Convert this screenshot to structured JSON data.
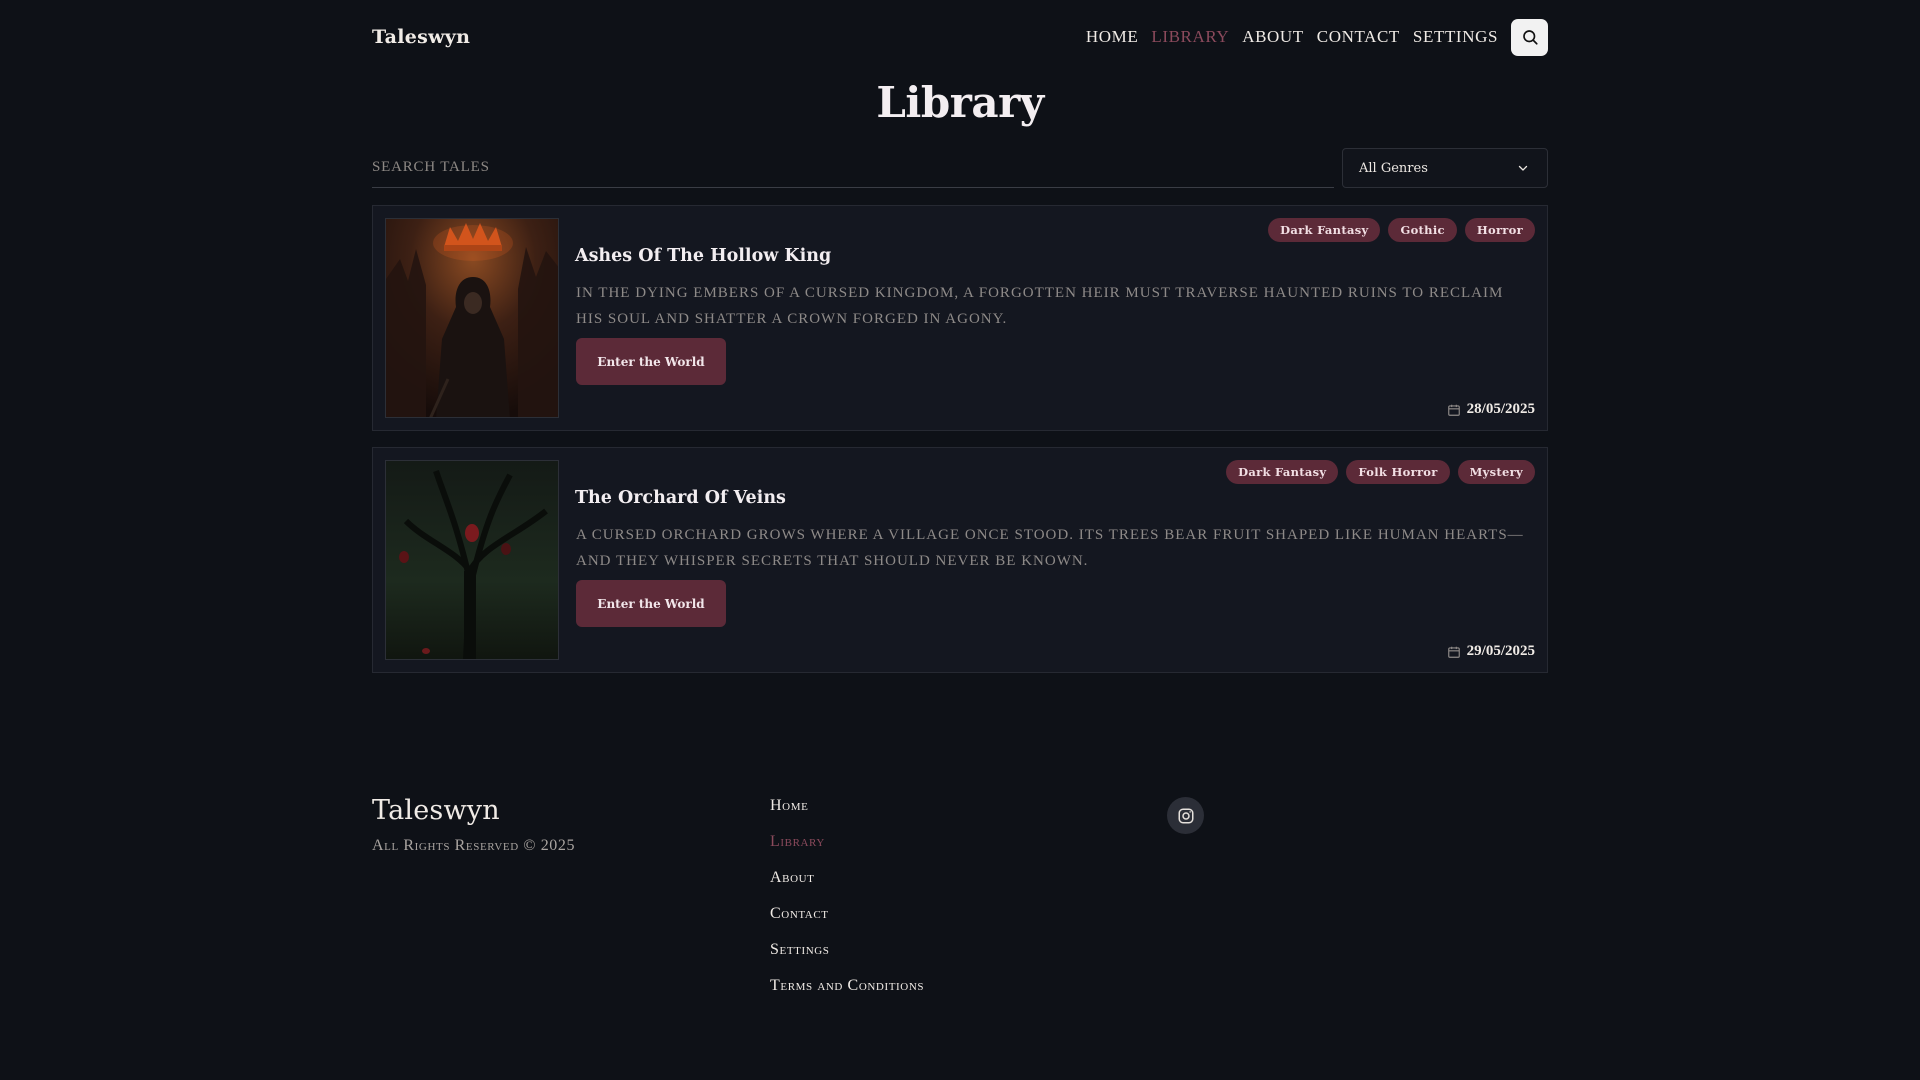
{
  "header": {
    "brand": "Taleswyn",
    "nav": [
      {
        "label": "HOME",
        "active": false
      },
      {
        "label": "LIBRARY",
        "active": true
      },
      {
        "label": "ABOUT",
        "active": false
      },
      {
        "label": "CONTACT",
        "active": false
      },
      {
        "label": "SETTINGS",
        "active": false
      }
    ],
    "search_icon": "search-icon"
  },
  "page": {
    "title": "Library"
  },
  "filters": {
    "search_placeholder": "SEARCH TALES",
    "search_value": "",
    "genre_selected": "All Genres",
    "genre_icon": "chevron-down-icon"
  },
  "tales": [
    {
      "title": "Ashes Of The Hollow King",
      "description": "In the dying embers of a cursed kingdom, a forgotten heir must traverse haunted ruins to reclaim his soul and shatter a crown forged in agony.",
      "tags": [
        "Dark Fantasy",
        "Gothic",
        "Horror"
      ],
      "cta": "Enter the World",
      "date": "28/05/2025",
      "cover": "hooded-king-cover"
    },
    {
      "title": "The Orchard Of Veins",
      "description": "A cursed orchard grows where a village once stood. Its trees bear fruit shaped like human hearts—and they whisper secrets that should never be known.",
      "tags": [
        "Dark Fantasy",
        "Folk Horror",
        "Mystery"
      ],
      "cta": "Enter the World",
      "date": "29/05/2025",
      "cover": "heart-tree-cover"
    }
  ],
  "footer": {
    "brand": "Taleswyn",
    "rights": "All Rights Reserved © 2025",
    "links": [
      {
        "label": "Home",
        "active": false
      },
      {
        "label": "Library",
        "active": true
      },
      {
        "label": "About",
        "active": false
      },
      {
        "label": "Contact",
        "active": false
      },
      {
        "label": "Settings",
        "active": false
      },
      {
        "label": "Terms and Conditions",
        "active": false
      }
    ],
    "social_icon": "instagram-icon"
  },
  "colors": {
    "background": "#0e1117",
    "card": "#141720",
    "accent": "#5c2a38",
    "active_link": "#8b4a5c"
  }
}
